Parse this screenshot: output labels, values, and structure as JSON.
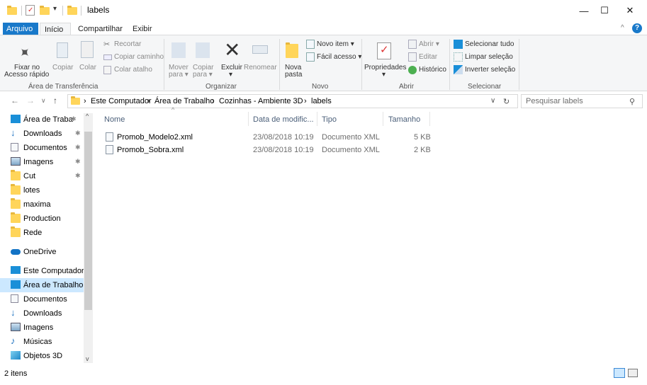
{
  "window": {
    "title": "labels",
    "minimize_glyph": "—",
    "maximize_glyph": "☐",
    "close_glyph": "✕",
    "quick_access_arrow": "▾"
  },
  "tabs": [
    "Arquivo",
    "Início",
    "Compartilhar",
    "Exibir"
  ],
  "ribbon": {
    "clipboard": {
      "pin_label_1": "Fixar no",
      "pin_label_2": "Acesso rápido",
      "copy": "Copiar",
      "paste": "Colar",
      "cut": "Recortar",
      "copy_path": "Copiar caminho",
      "paste_shortcut": "Colar atalho",
      "group": "Área de Transferência"
    },
    "organize": {
      "move_1": "Mover",
      "move_2": "para ▾",
      "copy_1": "Copiar",
      "copy_2": "para ▾",
      "delete": "Excluir",
      "delete_arrow": "▾",
      "rename": "Renomear",
      "group": "Organizar"
    },
    "new": {
      "new_folder_1": "Nova",
      "new_folder_2": "pasta",
      "new_item": "Novo item ▾",
      "easy_access": "Fácil acesso ▾",
      "group": "Novo"
    },
    "open": {
      "properties": "Propriedades",
      "properties_arrow": "▾",
      "open": "Abrir ▾",
      "edit": "Editar",
      "history": "Histórico",
      "group": "Abrir"
    },
    "select": {
      "select_all": "Selecionar tudo",
      "select_none": "Limpar seleção",
      "invert": "Inverter seleção",
      "group": "Selecionar"
    }
  },
  "address": {
    "crumbs": [
      "Este Computador",
      "Área de Trabalho",
      "Cozinhas - Ambiente 3D",
      "labels"
    ],
    "separator": "›",
    "search_placeholder": "Pesquisar labels",
    "refresh_glyph": "↻",
    "dropdown_glyph": "∨"
  },
  "nav": {
    "quick_access": [
      {
        "label": "Área de Traba",
        "pinned": true
      },
      {
        "label": "Downloads",
        "pinned": true
      },
      {
        "label": "Documentos",
        "pinned": true
      },
      {
        "label": "Imagens",
        "pinned": true
      },
      {
        "label": "Cut",
        "pinned": true
      },
      {
        "label": "lotes",
        "pinned": false
      },
      {
        "label": "maxima",
        "pinned": false
      },
      {
        "label": "Production",
        "pinned": false
      },
      {
        "label": "Rede",
        "pinned": false
      }
    ],
    "onedrive": "OneDrive",
    "this_pc": "Este Computador",
    "pc_items": [
      "Área de Trabalho",
      "Documentos",
      "Downloads",
      "Imagens",
      "Músicas",
      "Objetos 3D"
    ],
    "pin_glyph": "✱"
  },
  "columns": {
    "name": "Nome",
    "date": "Data de modific...",
    "type": "Tipo",
    "size": "Tamanho",
    "sort_glyph": "^"
  },
  "files": [
    {
      "name": "Promob_Modelo2.xml",
      "date": "23/08/2018 10:19",
      "type": "Documento XML",
      "size": "5 KB"
    },
    {
      "name": "Promob_Sobra.xml",
      "date": "23/08/2018 10:19",
      "type": "Documento XML",
      "size": "2 KB"
    }
  ],
  "status": {
    "count": "2 itens"
  },
  "colors": {
    "accent": "#1979ca",
    "selection": "#cce8ff",
    "folder": "#ffd55a"
  }
}
